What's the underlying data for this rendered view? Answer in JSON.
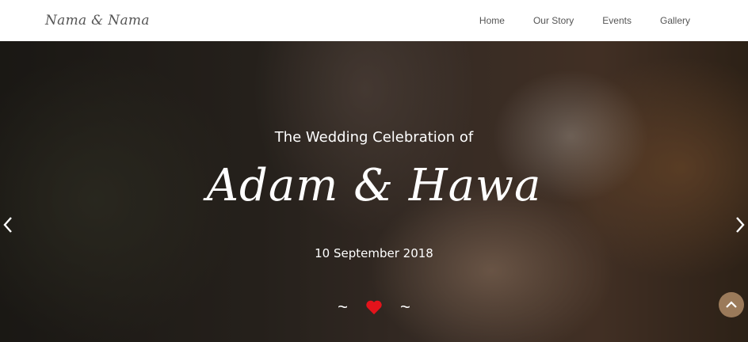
{
  "header": {
    "brand": "Nama & Nama",
    "nav": [
      "Home",
      "Our Story",
      "Events",
      "Gallery"
    ]
  },
  "hero": {
    "subtitle": "The Wedding Celebration of",
    "couple": "Adam & Hawa",
    "date": "10 September 2018",
    "divider_left": "~",
    "divider_right": "~"
  },
  "colors": {
    "heart": "#e3131b",
    "back_to_top": "#9b7a5a"
  },
  "icons": {
    "prev": "chevron-left-icon",
    "next": "chevron-right-icon",
    "heart": "heart-icon",
    "back_to_top": "chevron-up-icon"
  }
}
